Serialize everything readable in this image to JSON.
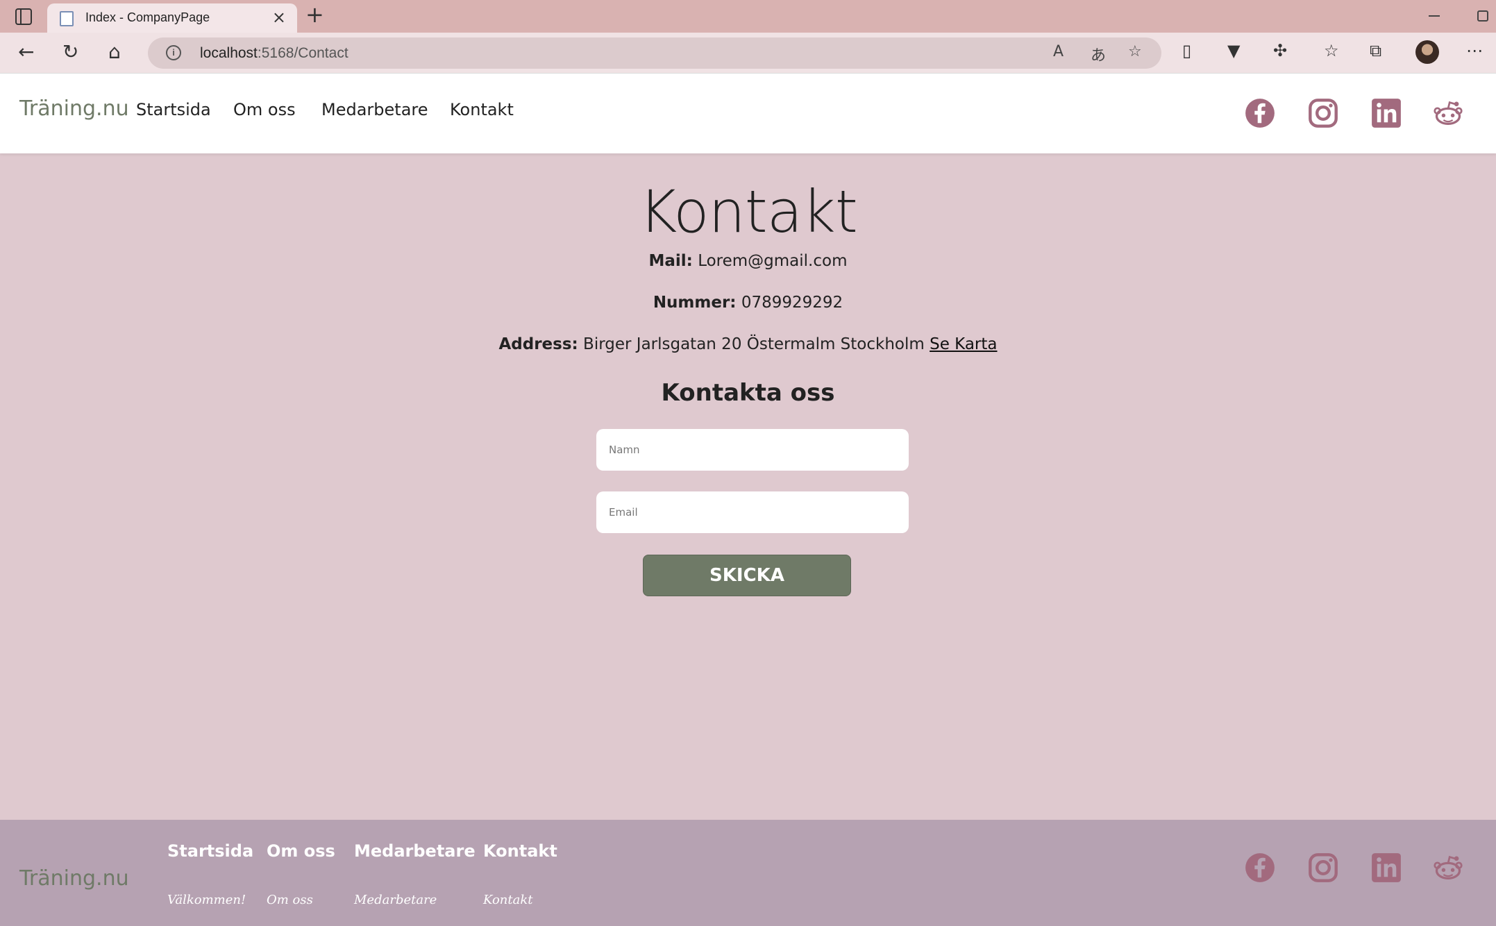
{
  "browser": {
    "tab_title": "Index - CompanyPage",
    "new_tab": "+",
    "close": "×",
    "address_host": "localhost",
    "address_path": ":5168/Contact"
  },
  "header": {
    "brand": "Träning.nu",
    "nav": [
      "Startsida",
      "Om oss",
      "Medarbetare",
      "Kontakt"
    ],
    "social": [
      "facebook-icon",
      "instagram-icon",
      "linkedin-icon",
      "reddit-icon"
    ],
    "icon_color": "#a26a7e"
  },
  "contact": {
    "title": "Kontakt",
    "mail_label": "Mail:",
    "mail_value": "Lorem@gmail.com",
    "number_label": "Nummer:",
    "number_value": "0789929292",
    "address_label": "Address:",
    "address_value": "Birger Jarlsgatan 20 Östermalm Stockholm",
    "map_link": "Se Karta"
  },
  "form": {
    "title": "Kontakta oss",
    "name_placeholder": "Namn",
    "email_placeholder": "Email",
    "submit_label": "SKICKA"
  },
  "footer": {
    "brand": "Träning.nu",
    "columns": [
      {
        "heading": "Startsida",
        "sub": "Välkommen!"
      },
      {
        "heading": "Om oss",
        "sub": "Om oss"
      },
      {
        "heading": "Medarbetare",
        "sub": "Medarbetare"
      },
      {
        "heading": "Kontakt",
        "sub": "Kontakt"
      }
    ]
  },
  "colors": {
    "page_bg": "#dfc9cf",
    "footer_bg": "#b6a2b2",
    "accent_green": "#6f7a67",
    "icon_pink": "#a26a7e"
  }
}
